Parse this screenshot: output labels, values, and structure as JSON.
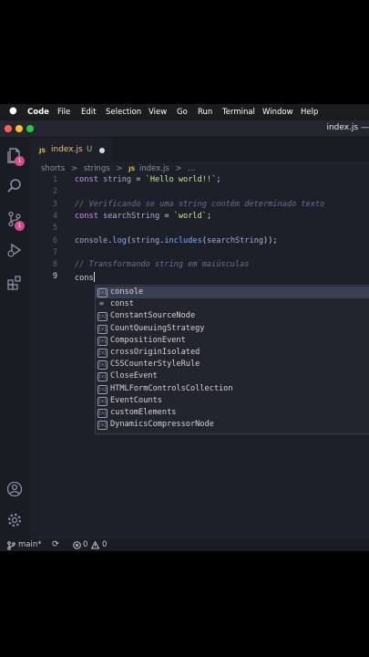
{
  "menubar": {
    "apple": "",
    "app": "Code",
    "items": [
      "File",
      "Edit",
      "Selection",
      "View",
      "Go",
      "Run",
      "Terminal",
      "Window",
      "Help"
    ]
  },
  "window": {
    "title": "index.js —",
    "traffic_colors": [
      "#ff5f57",
      "#febc2e",
      "#28c840"
    ]
  },
  "activity": {
    "explorer_badge": "1",
    "scm_badge": "1"
  },
  "tab": {
    "lang": "JS",
    "name": "index.js",
    "status": "U"
  },
  "breadcrumbs": [
    "shorts",
    ">",
    "strings",
    ">",
    "JS",
    "index.js",
    ">",
    "..."
  ],
  "editor": {
    "lines": [
      {
        "n": "1",
        "parts": [
          [
            "kw",
            "const"
          ],
          [
            "pl",
            " "
          ],
          [
            "var",
            "string"
          ],
          [
            "pl",
            " = "
          ],
          [
            "str",
            "`Hello world!!`"
          ],
          [
            "pl",
            ";"
          ]
        ]
      },
      {
        "n": "2",
        "parts": []
      },
      {
        "n": "3",
        "parts": [
          [
            "cm",
            "// Verificando se uma string contém determinado texto"
          ]
        ]
      },
      {
        "n": "4",
        "parts": [
          [
            "kw",
            "const"
          ],
          [
            "pl",
            " "
          ],
          [
            "var",
            "searchString"
          ],
          [
            "pl",
            " = "
          ],
          [
            "str",
            "`world`"
          ],
          [
            "pl",
            ";"
          ]
        ]
      },
      {
        "n": "5",
        "parts": []
      },
      {
        "n": "6",
        "parts": [
          [
            "var",
            "console"
          ],
          [
            "pl",
            "."
          ],
          [
            "fn",
            "log"
          ],
          [
            "pl",
            "("
          ],
          [
            "var",
            "string"
          ],
          [
            "pl",
            "."
          ],
          [
            "fn",
            "includes"
          ],
          [
            "pl",
            "("
          ],
          [
            "var",
            "searchString"
          ],
          [
            "pl",
            "));"
          ]
        ]
      },
      {
        "n": "7",
        "parts": []
      },
      {
        "n": "8",
        "parts": [
          [
            "cm",
            "// Transformando string em maiúsculas"
          ]
        ]
      },
      {
        "n": "9",
        "parts": [
          [
            "pl",
            "cons"
          ]
        ]
      }
    ]
  },
  "suggestions": [
    {
      "icon": "variable",
      "label": "console"
    },
    {
      "icon": "keyword",
      "label": "const"
    },
    {
      "icon": "variable",
      "label": "ConstantSourceNode"
    },
    {
      "icon": "variable",
      "label": "CountQueuingStrategy"
    },
    {
      "icon": "variable",
      "label": "CompositionEvent"
    },
    {
      "icon": "variable",
      "label": "crossOriginIsolated"
    },
    {
      "icon": "variable",
      "label": "CSSCounterStyleRule"
    },
    {
      "icon": "variable",
      "label": "CloseEvent"
    },
    {
      "icon": "variable",
      "label": "HTMLFormControlsCollection"
    },
    {
      "icon": "variable",
      "label": "EventCounts"
    },
    {
      "icon": "variable",
      "label": "customElements"
    },
    {
      "icon": "variable",
      "label": "DynamicsCompressorNode"
    }
  ],
  "statusbar": {
    "branch": "main*",
    "errors": "0",
    "warnings": "0"
  }
}
